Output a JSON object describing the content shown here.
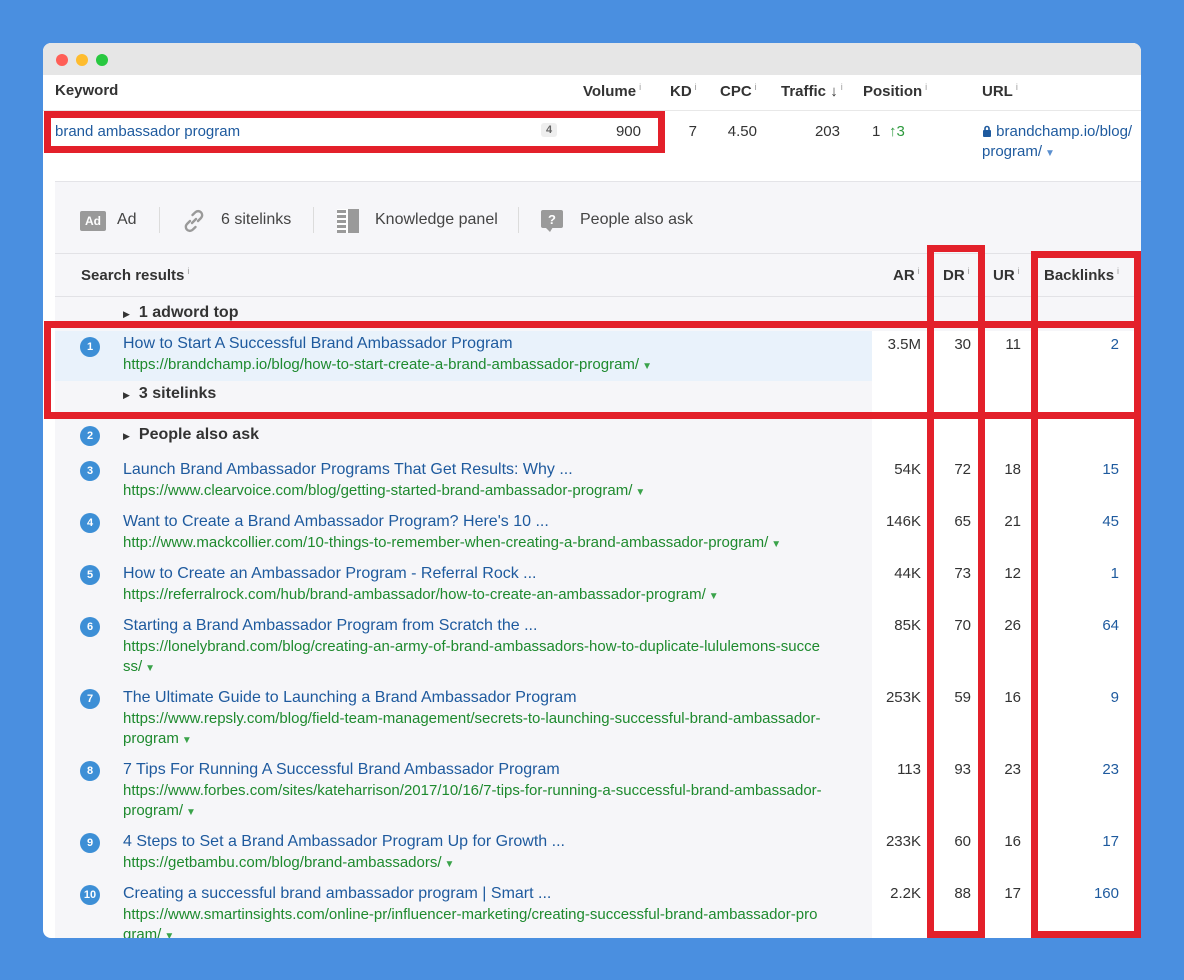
{
  "colors": {
    "background": "#4a8fe0",
    "highlight": "#e3202a",
    "link": "#1e5a9e",
    "url": "#1e8a2e",
    "rank_badge": "#3d8fd6"
  },
  "keyword_table": {
    "headers": {
      "keyword": "Keyword",
      "volume": "Volume",
      "kd": "KD",
      "cpc": "CPC",
      "traffic": "Traffic",
      "traffic_sort": "↓",
      "position": "Position",
      "url": "URL",
      "info": "i"
    },
    "row": {
      "keyword": "brand ambassador program",
      "badge": "4",
      "volume": "900",
      "kd": "7",
      "cpc": "4.50",
      "traffic": "203",
      "position": "1",
      "position_change": "↑3",
      "url_line1": "brandchamp.io/blog/",
      "url_line2": "program/",
      "lock_icon": "lock-icon"
    }
  },
  "serp_features": [
    {
      "icon": "ad-icon",
      "icon_text": "Ad",
      "label": "Ad"
    },
    {
      "icon": "link-icon",
      "label": "6 sitelinks"
    },
    {
      "icon": "knowledge-panel-icon",
      "label": "Knowledge panel"
    },
    {
      "icon": "question-icon",
      "icon_text": "?",
      "label": "People also ask"
    }
  ],
  "serp_table": {
    "headers": {
      "search_results": "Search results",
      "ar": "AR",
      "dr": "DR",
      "ur": "UR",
      "backlinks": "Backlinks",
      "info": "i"
    },
    "adword": "1 adword top",
    "sitelinks_sub": "3 sitelinks",
    "paa": "People also ask",
    "results": [
      {
        "rank": "1",
        "title": "How to Start A Successful Brand Ambassador Program",
        "url": "https://brandchamp.io/blog/how-to-start-create-a-brand-ambassador-program/",
        "ar": "3.5M",
        "dr": "30",
        "ur": "11",
        "backlinks": "2"
      },
      {
        "rank": "2"
      },
      {
        "rank": "3",
        "title": "Launch Brand Ambassador Programs That Get Results: Why ...",
        "url": "https://www.clearvoice.com/blog/getting-started-brand-ambassador-program/",
        "ar": "54K",
        "dr": "72",
        "ur": "18",
        "backlinks": "15"
      },
      {
        "rank": "4",
        "title": "Want to Create a Brand Ambassador Program? Here's 10 ...",
        "url": "http://www.mackcollier.com/10-things-to-remember-when-creating-a-brand-ambassador-program/",
        "ar": "146K",
        "dr": "65",
        "ur": "21",
        "backlinks": "45"
      },
      {
        "rank": "5",
        "title": "How to Create an Ambassador Program - Referral Rock ...",
        "url": "https://referralrock.com/hub/brand-ambassador/how-to-create-an-ambassador-program/",
        "ar": "44K",
        "dr": "73",
        "ur": "12",
        "backlinks": "1"
      },
      {
        "rank": "6",
        "title": "Starting a Brand Ambassador Program from Scratch the ...",
        "url": "https://lonelybrand.com/blog/creating-an-army-of-brand-ambassadors-how-to-duplicate-lululemons-succe",
        "url2": "ss/",
        "ar": "85K",
        "dr": "70",
        "ur": "26",
        "backlinks": "64"
      },
      {
        "rank": "7",
        "title": "The Ultimate Guide to Launching a Brand Ambassador Program",
        "url": "https://www.repsly.com/blog/field-team-management/secrets-to-launching-successful-brand-ambassador-",
        "url2": "program",
        "ar": "253K",
        "dr": "59",
        "ur": "16",
        "backlinks": "9"
      },
      {
        "rank": "8",
        "title": "7 Tips For Running A Successful Brand Ambassador Program",
        "url": "https://www.forbes.com/sites/kateharrison/2017/10/16/7-tips-for-running-a-successful-brand-ambassador-",
        "url2": "program/",
        "ar": "113",
        "dr": "93",
        "ur": "23",
        "backlinks": "23"
      },
      {
        "rank": "9",
        "title": "4 Steps to Set a Brand Ambassador Program Up for Growth ...",
        "url": "https://getbambu.com/blog/brand-ambassadors/",
        "ar": "233K",
        "dr": "60",
        "ur": "16",
        "backlinks": "17"
      },
      {
        "rank": "10",
        "title": "Creating a successful brand ambassador program | Smart ...",
        "url": "https://www.smartinsights.com/online-pr/influencer-marketing/creating-successful-brand-ambassador-pro",
        "url2": "gram/",
        "ar": "2.2K",
        "dr": "88",
        "ur": "17",
        "backlinks": "160"
      }
    ]
  }
}
